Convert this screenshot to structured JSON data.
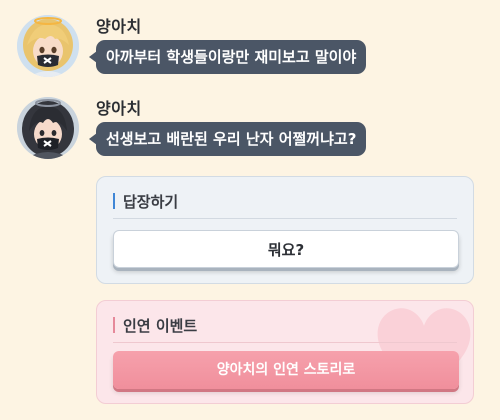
{
  "messages": [
    {
      "sender": "양아치",
      "text": "아까부터 학생들이랑만 재미보고 말이야"
    },
    {
      "sender": "양아치",
      "text": "선생보고 배란된 우리 난자 어쩔꺼냐고?"
    }
  ],
  "reply_panel": {
    "title": "답장하기",
    "option_label": "뭐요?"
  },
  "event_panel": {
    "title": "인연 이벤트",
    "button_label": "양아치의 인연 스토리로"
  },
  "colors": {
    "background": "#fdf4e3",
    "bubble": "#4b5666",
    "reply_accent": "#3f86d6",
    "event_accent": "#e6899a",
    "event_button": "#f39aa6"
  },
  "icons": {
    "avatar_1": "blonde-masked-student-avatar",
    "avatar_2": "dark-haired-masked-student-avatar",
    "event_decoration": "heart-icon"
  }
}
